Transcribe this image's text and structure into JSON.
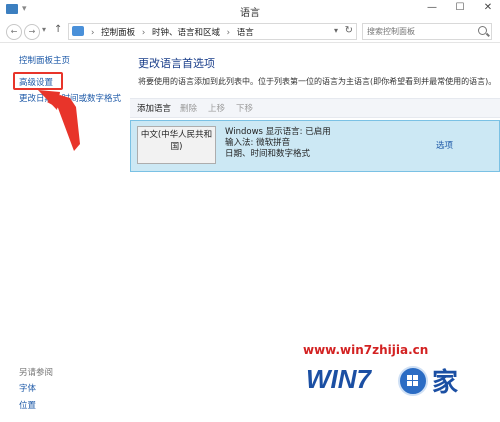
{
  "window": {
    "title": "语言"
  },
  "address": {
    "crumbs": [
      "控制面板",
      "时钟、语言和区域",
      "语言"
    ],
    "search_placeholder": "搜索控制面板"
  },
  "sidebar": {
    "home": "控制面板主页",
    "advanced": "高级设置",
    "date_format": "更改日期、时间或数字格式",
    "see_also": "另请参阅",
    "fonts": "字体",
    "location": "位置"
  },
  "main": {
    "heading": "更改语言首选项",
    "description": "将要使用的语言添加到此列表中。位于列表第一位的语言为主语言(即你希望看到并最常使用的语言)。",
    "toolbar": {
      "add": "添加语言",
      "remove": "删除",
      "up": "上移",
      "down": "下移"
    },
    "language": {
      "name": "中文(中华人民共和国)",
      "info": [
        "Windows 显示语言: 已启用",
        "输入法: 微软拼音",
        "日期、时间和数字格式"
      ],
      "options": "选项"
    }
  },
  "watermark": {
    "url": "www.win7zhijia.cn",
    "logo_text": "WIN7",
    "logo_char": "家"
  },
  "colors": {
    "accent": "#1e5aa8",
    "selection": "#cce8f4",
    "annotation": "#e8342a"
  }
}
